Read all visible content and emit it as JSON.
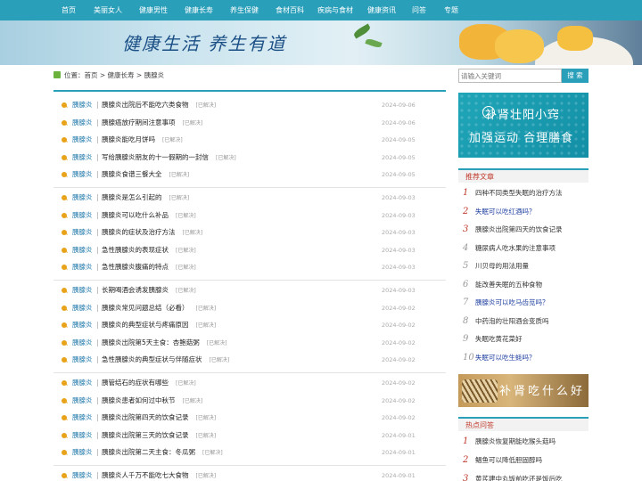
{
  "nav": {
    "items": [
      "首页",
      "美丽女人",
      "健康男性",
      "健康长寿",
      "养生保健",
      "食材百科",
      "疾病与食材",
      "健康资讯",
      "问答",
      "专题"
    ]
  },
  "banner": {
    "slogan": "健康生活  养生有道"
  },
  "breadcrumb": {
    "text": "位置：首页 > 健康长寿 > 胰腺炎"
  },
  "articles": [
    {
      "category": "胰腺炎",
      "title": "胰腺炎出院后不能吃六类食物",
      "status": "[已解决]",
      "date": "2024-09-06"
    },
    {
      "category": "胰腺炎",
      "title": "胰腺癌放疗期间注意事项",
      "status": "[已解决]",
      "date": "2024-09-06"
    },
    {
      "category": "胰腺炎",
      "title": "胰腺炎能吃月饼吗",
      "status": "[已解决]",
      "date": "2024-09-05"
    },
    {
      "category": "胰腺炎",
      "title": "写给胰腺炎朋友的十一假期的一封信",
      "status": "[已解决]",
      "date": "2024-09-05"
    },
    {
      "category": "胰腺炎",
      "title": "胰腺炎食谱三餐大全",
      "status": "[已解决]",
      "date": "2024-09-05"
    },
    {
      "category": "胰腺炎",
      "title": "胰腺炎是怎么引起的",
      "status": "[已解决]",
      "date": "2024-09-03"
    },
    {
      "category": "胰腺炎",
      "title": "胰腺炎可以吃什么补品",
      "status": "[已解决]",
      "date": "2024-09-03"
    },
    {
      "category": "胰腺炎",
      "title": "胰腺炎的症状及治疗方法",
      "status": "[已解决]",
      "date": "2024-09-03"
    },
    {
      "category": "胰腺炎",
      "title": "急性胰腺炎的表现症状",
      "status": "[已解决]",
      "date": "2024-09-03"
    },
    {
      "category": "胰腺炎",
      "title": "急性胰腺炎腹痛的特点",
      "status": "[已解决]",
      "date": "2024-09-03"
    },
    {
      "category": "胰腺炎",
      "title": "长期喝酒会诱发胰腺炎",
      "status": "[已解决]",
      "date": "2024-09-03"
    },
    {
      "category": "胰腺炎",
      "title": "胰腺炎常见问题总结（必看）",
      "status": "[已解决]",
      "date": "2024-09-02"
    },
    {
      "category": "胰腺炎",
      "title": "胰腺炎的典型症状与疼痛原因",
      "status": "[已解决]",
      "date": "2024-09-02"
    },
    {
      "category": "胰腺炎",
      "title": "胰腺炎出院第5天主食：杏鲍菇粥",
      "status": "[已解决]",
      "date": "2024-09-02"
    },
    {
      "category": "胰腺炎",
      "title": "急性胰腺炎的典型症状与伴随症状",
      "status": "[已解决]",
      "date": "2024-09-02"
    },
    {
      "category": "胰腺炎",
      "title": "胰管结石的症状有哪些",
      "status": "[已解决]",
      "date": "2024-09-02"
    },
    {
      "category": "胰腺炎",
      "title": "胰腺炎患者如何过中秋节",
      "status": "[已解决]",
      "date": "2024-09-02"
    },
    {
      "category": "胰腺炎",
      "title": "胰腺炎出院第四天的饮食记录",
      "status": "[已解决]",
      "date": "2024-09-02"
    },
    {
      "category": "胰腺炎",
      "title": "胰腺炎出院第三天的饮食记录",
      "status": "[已解决]",
      "date": "2024-09-01"
    },
    {
      "category": "胰腺炎",
      "title": "胰腺炎出院第二天主食：冬瓜粥",
      "status": "[已解决]",
      "date": "2024-09-01"
    },
    {
      "category": "胰腺炎",
      "title": "胰腺炎人千万不能吃七大食物",
      "status": "[已解决]",
      "date": "2024-09-01"
    }
  ],
  "sidebar": {
    "search_placeholder": "请输入关键词",
    "search_button": "搜 索",
    "ad1": {
      "line1": "补肾壮阳小窍",
      "line2": "加强运动 合理膳食"
    },
    "recommend": {
      "title": "推荐文章",
      "items": [
        {
          "num": "1",
          "text": "四种不同类型失眠的治疗方法"
        },
        {
          "num": "2",
          "text": "失眠可以吃红酒吗？"
        },
        {
          "num": "3",
          "text": "胰腺炎出院第四天的饮食记录"
        },
        {
          "num": "4",
          "text": "糖尿病人吃水果的注意事项"
        },
        {
          "num": "5",
          "text": "川贝母的用法用量"
        },
        {
          "num": "6",
          "text": "能改善失眠的五种食物"
        },
        {
          "num": "7",
          "text": "胰腺炎可以吃马齿苋吗？"
        },
        {
          "num": "8",
          "text": "中药泡的壮阳酒会变质吗"
        },
        {
          "num": "9",
          "text": "失眠吃黄花菜好"
        },
        {
          "num": "10",
          "text": "失眠可以吃生蚝吗？"
        }
      ]
    },
    "ad2": {
      "text": "补肾吃什么好"
    },
    "hot": {
      "title": "热点问答",
      "items": [
        {
          "num": "1",
          "text": "胰腺炎恢复期能吃猴头菇吗"
        },
        {
          "num": "2",
          "text": "鲳鱼可以降低胆固醇吗"
        },
        {
          "num": "3",
          "text": "黄芪建中丸饭前吃还是饭后吃"
        }
      ]
    }
  },
  "colors": {
    "accent": "#2a9fba",
    "link": "#1d76a8",
    "highlight": "#c0392b"
  }
}
